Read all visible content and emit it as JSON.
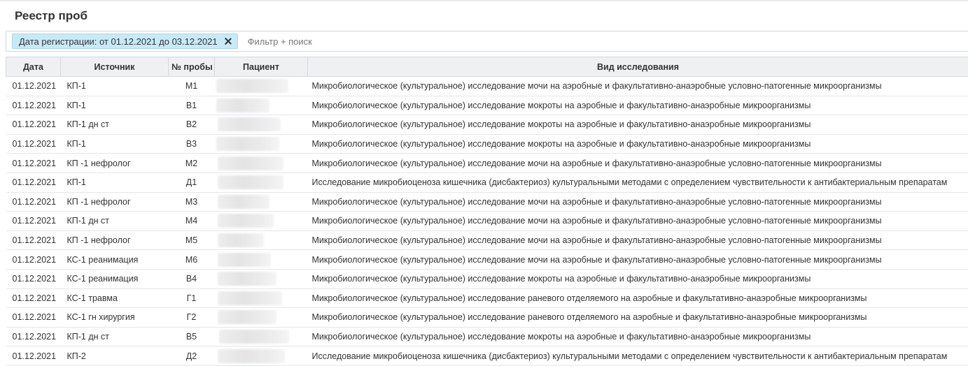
{
  "page": {
    "title": "Реестр проб"
  },
  "filter": {
    "chip_label": "Дата регистрации: от 01.12.2021 до 03.12.2021",
    "placeholder": "Фильтр + поиск"
  },
  "table": {
    "columns": [
      "Дата",
      "Источник",
      "№ пробы",
      "Пациент",
      "Вид исследования"
    ],
    "rows": [
      {
        "date": "01.12.2021",
        "source": "КП-1",
        "sample": "М1",
        "patient": "",
        "type": "Микробиологическое (культуральное) исследование мочи на аэробные и факультативно-анаэробные условно-патогенные микроорганизмы"
      },
      {
        "date": "01.12.2021",
        "source": "КП-1",
        "sample": "В1",
        "patient": "",
        "type": "Микробиологическое (культуральное) исследование мокроты на аэробные и факультативно-анаэробные микроорганизмы"
      },
      {
        "date": "01.12.2021",
        "source": "КП-1 дн ст",
        "sample": "В2",
        "patient": "",
        "type": "Микробиологическое (культуральное) исследование мокроты на аэробные и факультативно-анаэробные микроорганизмы"
      },
      {
        "date": "01.12.2021",
        "source": "КП-1",
        "sample": "В3",
        "patient": "",
        "type": "Микробиологическое (культуральное) исследование мокроты на аэробные и факультативно-анаэробные микроорганизмы"
      },
      {
        "date": "01.12.2021",
        "source": "КП -1 нефролог",
        "sample": "М2",
        "patient": "",
        "type": "Микробиологическое (культуральное) исследование мочи на аэробные и факультативно-анаэробные условно-патогенные микроорганизмы"
      },
      {
        "date": "01.12.2021",
        "source": "КП-1",
        "sample": "Д1",
        "patient": "",
        "type": "Исследование микробиоценоза кишечника (дисбактериоз) культуральными методами с определением чувствительности к антибактериальным препаратам"
      },
      {
        "date": "01.12.2021",
        "source": "КП -1 нефролог",
        "sample": "М3",
        "patient": "",
        "type": "Микробиологическое (культуральное) исследование мочи на аэробные и факультативно-анаэробные условно-патогенные микроорганизмы"
      },
      {
        "date": "01.12.2021",
        "source": "КП-1 дн ст",
        "sample": "М4",
        "patient": "",
        "type": "Микробиологическое (культуральное) исследование мочи на аэробные и факультативно-анаэробные условно-патогенные микроорганизмы"
      },
      {
        "date": "01.12.2021",
        "source": "КП -1 нефролог",
        "sample": "М5",
        "patient": "",
        "type": "Микробиологическое (культуральное) исследование мочи на аэробные и факультативно-анаэробные условно-патогенные микроорганизмы"
      },
      {
        "date": "01.12.2021",
        "source": "КС-1 реанимация",
        "sample": "М6",
        "patient": "",
        "type": "Микробиологическое (культуральное) исследование мочи на аэробные и факультативно-анаэробные условно-патогенные микроорганизмы"
      },
      {
        "date": "01.12.2021",
        "source": "КС-1 реанимация",
        "sample": "В4",
        "patient": "",
        "type": "Микробиологическое (культуральное) исследование мокроты на аэробные и факультативно-анаэробные микроорганизмы"
      },
      {
        "date": "01.12.2021",
        "source": "КС-1 травма",
        "sample": "Г1",
        "patient": "",
        "type": "Микробиологическое (культуральное) исследование раневого отделяемого на аэробные и факультативно-анаэробные микроорганизмы"
      },
      {
        "date": "01.12.2021",
        "source": "КС-1 гн хирургия",
        "sample": "Г2",
        "patient": "",
        "type": "Микробиологическое (культуральное) исследование раневого отделяемого на аэробные и факультативно-анаэробные микроорганизмы"
      },
      {
        "date": "01.12.2021",
        "source": "КП-1 дн ст",
        "sample": "В5",
        "patient": "",
        "type": "Микробиологическое (культуральное) исследование мокроты на аэробные и факультативно-анаэробные микроорганизмы"
      },
      {
        "date": "01.12.2021",
        "source": "КП-2",
        "sample": "Д2",
        "patient": "",
        "type": "Исследование микробиоценоза кишечника (дисбактериоз) культуральными методами с определением чувствительности к антибактериальным препаратам"
      }
    ]
  }
}
